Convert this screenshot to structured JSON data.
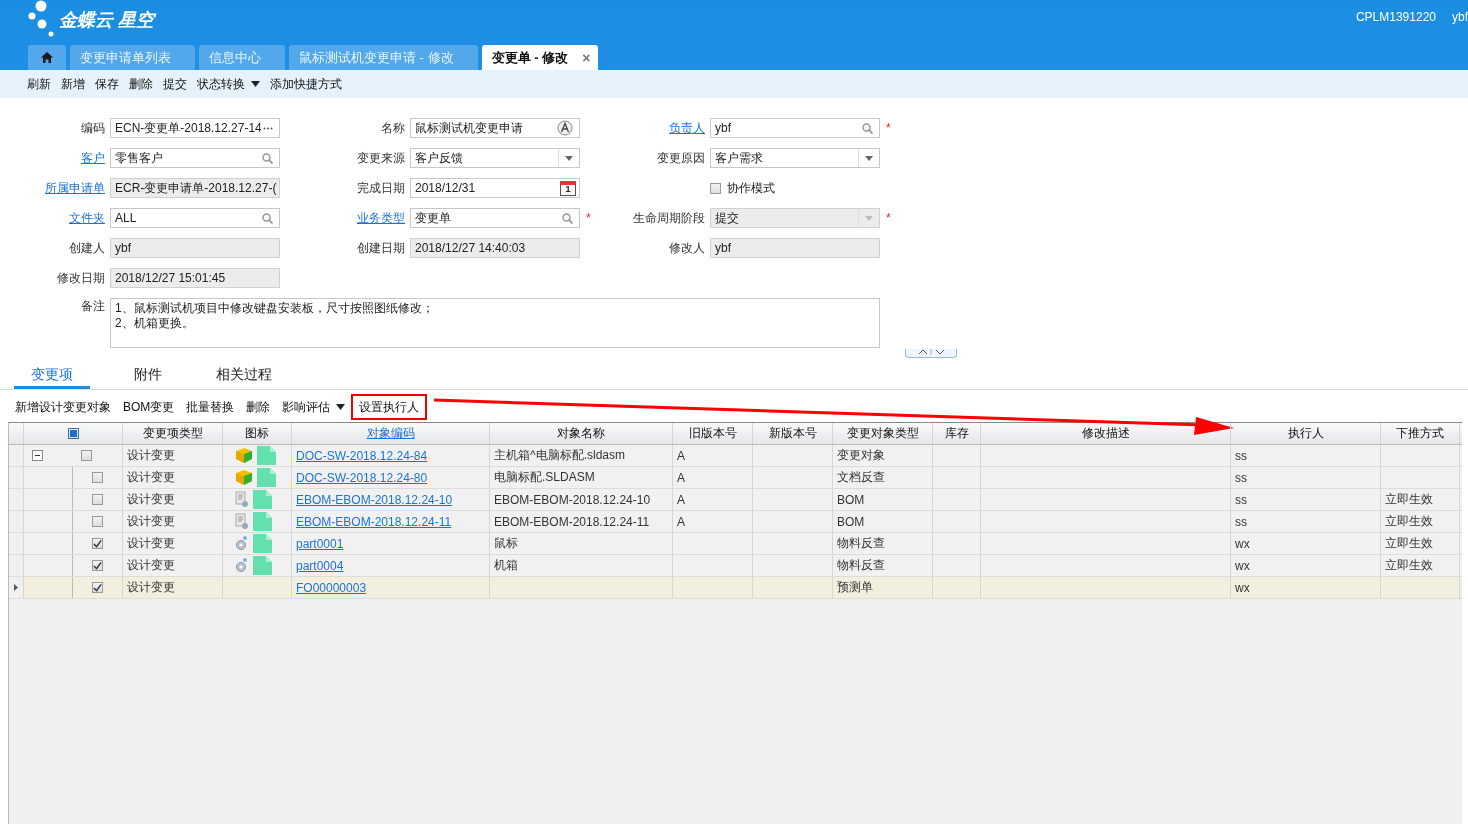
{
  "header": {
    "logo": "金蝶云 星空",
    "account": "CPLM1391220",
    "user": "ybf"
  },
  "tabs": [
    {
      "kind": "home",
      "selected": false
    },
    {
      "kind": "page",
      "label": "变更申请单列表",
      "selected": false
    },
    {
      "kind": "page",
      "label": "信息中心",
      "selected": false
    },
    {
      "kind": "page",
      "label": "鼠标测试机变更申请 - 修改",
      "selected": false
    },
    {
      "kind": "page",
      "label": "变更单 - 修改",
      "selected": true,
      "close": "×"
    }
  ],
  "toolbar": [
    {
      "label": "刷新",
      "dropdown": false
    },
    {
      "label": "新增",
      "dropdown": false
    },
    {
      "label": "保存",
      "dropdown": false
    },
    {
      "label": "删除",
      "dropdown": false
    },
    {
      "label": "提交",
      "dropdown": false
    },
    {
      "label": "状态转换",
      "dropdown": true
    },
    {
      "label": "添加快捷方式",
      "dropdown": false
    }
  ],
  "form": {
    "fields": [
      {
        "label": "编码",
        "link": false,
        "kind": "more",
        "value": "ECN-变更单-2018.12.27-14",
        "disabled": false,
        "required": false
      },
      {
        "label": "名称",
        "link": false,
        "kind": "lang",
        "value": "鼠标测试机变更申请",
        "disabled": false,
        "required": false
      },
      {
        "label": "负责人",
        "link": true,
        "kind": "lookup",
        "value": "ybf",
        "disabled": false,
        "required": true
      },
      {
        "label": "客户",
        "link": true,
        "kind": "lookup",
        "value": "零售客户",
        "disabled": false,
        "required": false
      },
      {
        "label": "变更来源",
        "link": false,
        "kind": "select",
        "value": "客户反馈",
        "disabled": false,
        "required": false
      },
      {
        "label": "变更原因",
        "link": false,
        "kind": "select",
        "value": "客户需求",
        "disabled": false,
        "required": false
      },
      {
        "label": "所属申请单",
        "link": true,
        "kind": "text",
        "value": "ECR-变更申请单-2018.12.27-(",
        "disabled": true,
        "required": false
      },
      {
        "label": "完成日期",
        "link": false,
        "kind": "date",
        "value": "2018/12/31",
        "disabled": false,
        "required": false,
        "calendar_day": "1"
      },
      {
        "label": "协作模式",
        "link": false,
        "kind": "checkbox",
        "checked": false,
        "disabled": false,
        "required": false
      },
      {
        "label": "文件夹",
        "link": true,
        "kind": "lookup",
        "value": "ALL",
        "disabled": false,
        "required": false
      },
      {
        "label": "业务类型",
        "link": true,
        "kind": "lookup",
        "value": "变更单",
        "disabled": false,
        "required": true
      },
      {
        "label": "生命周期阶段",
        "link": false,
        "kind": "select",
        "value": "提交",
        "disabled": true,
        "required": true
      },
      {
        "label": "创建人",
        "link": false,
        "kind": "text",
        "value": "ybf",
        "disabled": true,
        "required": false
      },
      {
        "label": "创建日期",
        "link": false,
        "kind": "text",
        "value": "2018/12/27 14:40:03",
        "disabled": true,
        "required": false
      },
      {
        "label": "修改人",
        "link": false,
        "kind": "text",
        "value": "ybf",
        "disabled": true,
        "required": false
      },
      {
        "label": "修改日期",
        "link": false,
        "kind": "text",
        "value": "2018/12/27 15:01:45",
        "disabled": true,
        "required": false
      }
    ],
    "remarks": {
      "label": "备注",
      "value": "1、鼠标测试机项目中修改键盘安装板，尺寸按照图纸修改；\n2、机箱更换。"
    },
    "required_mark": "*"
  },
  "subtabs": [
    {
      "label": "变更项",
      "selected": true
    },
    {
      "label": "附件",
      "selected": false
    },
    {
      "label": "相关过程",
      "selected": false
    }
  ],
  "grid_toolbar": [
    {
      "label": "新增设计变更对象",
      "dropdown": false,
      "highlighted": false
    },
    {
      "label": "BOM变更",
      "dropdown": false,
      "highlighted": false
    },
    {
      "label": "批量替换",
      "dropdown": false,
      "highlighted": false
    },
    {
      "label": "删除",
      "dropdown": false,
      "highlighted": false
    },
    {
      "label": "影响评估",
      "dropdown": true,
      "highlighted": false
    },
    {
      "label": "设置执行人",
      "dropdown": false,
      "highlighted": true
    }
  ],
  "table": {
    "select_all_partial": true,
    "columns": [
      {
        "label": "变更项类型",
        "link": false
      },
      {
        "label": "图标",
        "link": false
      },
      {
        "label": "对象编码",
        "link": true
      },
      {
        "label": "对象名称",
        "link": false
      },
      {
        "label": "旧版本号",
        "link": false
      },
      {
        "label": "新版本号",
        "link": false
      },
      {
        "label": "变更对象类型",
        "link": false
      },
      {
        "label": "库存",
        "link": false
      },
      {
        "label": "修改描述",
        "link": false
      },
      {
        "label": "执行人",
        "link": false
      },
      {
        "label": "下推方式",
        "link": false
      }
    ],
    "rows": [
      {
        "checked": false,
        "selected": false,
        "expanded": true,
        "type": "设计变更",
        "kind": "assembly",
        "code": "DOC-SW-2018.12.24-84",
        "name": "主机箱^电脑标配.sldasm",
        "old_version": "A",
        "object_type": "变更对象",
        "executor": "ss",
        "children": [
          {
            "checked": false,
            "selected": false,
            "type": "设计变更",
            "kind": "assembly",
            "code": "DOC-SW-2018.12.24-80",
            "name": "电脑标配.SLDASM",
            "old_version": "A",
            "object_type": "文档反查",
            "executor": "ss"
          },
          {
            "checked": false,
            "selected": false,
            "type": "设计变更",
            "kind": "bom",
            "code": "EBOM-EBOM-2018.12.24-10",
            "name": "EBOM-EBOM-2018.12.24-10",
            "old_version": "A",
            "object_type": "BOM",
            "executor": "ss",
            "push_mode": "立即生效"
          },
          {
            "checked": false,
            "selected": false,
            "type": "设计变更",
            "kind": "bom",
            "code": "EBOM-EBOM-2018.12.24-11",
            "name": "EBOM-EBOM-2018.12.24-11",
            "old_version": "A",
            "object_type": "BOM",
            "executor": "ss",
            "push_mode": "立即生效"
          },
          {
            "checked": true,
            "selected": false,
            "type": "设计变更",
            "kind": "part",
            "code": "part0001",
            "name": "鼠标",
            "object_type": "物料反查",
            "executor": "wx",
            "push_mode": "立即生效"
          },
          {
            "checked": true,
            "selected": false,
            "type": "设计变更",
            "kind": "part",
            "code": "part0004",
            "name": "机箱",
            "object_type": "物料反查",
            "executor": "wx",
            "push_mode": "立即生效"
          },
          {
            "checked": true,
            "selected": true,
            "type": "设计变更",
            "kind": "plain",
            "code": "FO00000003",
            "object_type": "预测单",
            "executor": "wx"
          }
        ]
      }
    ]
  }
}
